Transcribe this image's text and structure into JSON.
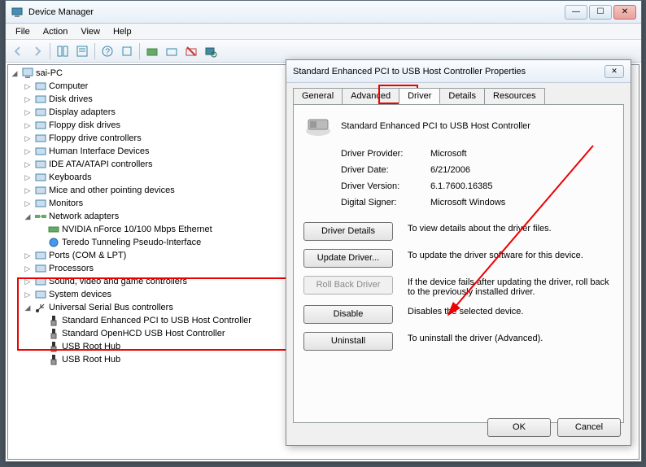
{
  "window": {
    "title": "Device Manager"
  },
  "menu": {
    "file": "File",
    "action": "Action",
    "view": "View",
    "help": "Help"
  },
  "tree": {
    "root": "sai-PC",
    "items": [
      "Computer",
      "Disk drives",
      "Display adapters",
      "Floppy disk drives",
      "Floppy drive controllers",
      "Human Interface Devices",
      "IDE ATA/ATAPI controllers",
      "Keyboards",
      "Mice and other pointing devices",
      "Monitors"
    ],
    "network": {
      "label": "Network adapters",
      "children": [
        "NVIDIA nForce 10/100 Mbps Ethernet",
        "Teredo Tunneling Pseudo-Interface"
      ]
    },
    "items2": [
      "Ports (COM & LPT)",
      "Processors",
      "Sound, video and game controllers",
      "System devices"
    ],
    "usb": {
      "label": "Universal Serial Bus controllers",
      "children": [
        "Standard Enhanced PCI to USB Host Controller",
        "Standard OpenHCD USB Host Controller",
        "USB Root Hub",
        "USB Root Hub"
      ]
    }
  },
  "dialog": {
    "title": "Standard Enhanced PCI to USB Host Controller Properties",
    "tabs": {
      "general": "General",
      "advanced": "Advanced",
      "driver": "Driver",
      "details": "Details",
      "resources": "Resources"
    },
    "device_name": "Standard Enhanced PCI to USB Host Controller",
    "info": {
      "provider_label": "Driver Provider:",
      "provider": "Microsoft",
      "date_label": "Driver Date:",
      "date": "6/21/2006",
      "version_label": "Driver Version:",
      "version": "6.1.7600.16385",
      "signer_label": "Digital Signer:",
      "signer": "Microsoft Windows"
    },
    "buttons": {
      "details": "Driver Details",
      "details_desc": "To view details about the driver files.",
      "update": "Update Driver...",
      "update_desc": "To update the driver software for this device.",
      "rollback": "Roll Back Driver",
      "rollback_desc": "If the device fails after updating the driver, roll back to the previously installed driver.",
      "disable": "Disable",
      "disable_desc": "Disables the selected device.",
      "uninstall": "Uninstall",
      "uninstall_desc": "To uninstall the driver (Advanced)."
    },
    "ok": "OK",
    "cancel": "Cancel"
  }
}
